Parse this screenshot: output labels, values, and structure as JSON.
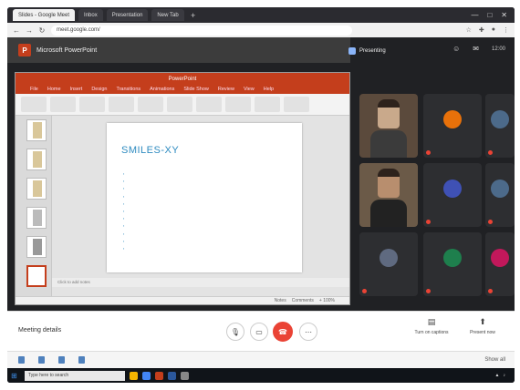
{
  "browser": {
    "tabs": [
      {
        "label": "Slides - Google Meet"
      },
      {
        "label": "Inbox"
      },
      {
        "label": "Presentation"
      },
      {
        "label": "New Tab"
      }
    ],
    "url": "meet.google.com/",
    "window_controls": [
      "—",
      "□",
      "✕"
    ]
  },
  "meet": {
    "share_app": "Microsoft PowerPoint",
    "presenter_label": "Presenting",
    "top_icons": [
      "people-icon",
      "chat-icon",
      "activities-icon"
    ],
    "clock": "12:00"
  },
  "ppt": {
    "window_title": "PowerPoint",
    "account": "",
    "menu": [
      "File",
      "Home",
      "Insert",
      "Design",
      "Transitions",
      "Animations",
      "Slide Show",
      "Review",
      "View",
      "Help"
    ],
    "slide_title": "SMILES-XY",
    "bullets": [
      "",
      "",
      "",
      "",
      "",
      "",
      "",
      "",
      "",
      "",
      ""
    ],
    "notes_placeholder": "Click to add notes",
    "status_items": [
      "Notes",
      "Comments",
      "+ 100%"
    ],
    "thumbnail_count": 6,
    "selected_thumbnail": 1
  },
  "participants": [
    {
      "name": "",
      "initial": "",
      "color": "#e8710a"
    },
    {
      "name": "",
      "initial": "",
      "color": "#4c6a8a"
    },
    {
      "name": "",
      "initial": "",
      "color": "#3f51b5"
    },
    {
      "name": "",
      "initial": "",
      "color": "#4c6a8a"
    },
    {
      "name": "",
      "initial": "",
      "color": "#5f6a80"
    },
    {
      "name": "",
      "initial": "",
      "color": "#1e7f4d"
    },
    {
      "name": "",
      "initial": "",
      "color": "#c2185b"
    }
  ],
  "controls": {
    "meeting_details": "Meeting details",
    "mic_icon": "mic-icon",
    "camera_icon": "camera-icon",
    "end_icon": "phone-end-icon",
    "captions_icon": "captions-icon",
    "present_label": "Present now",
    "captions_label": "Turn on captions"
  },
  "downloads": {
    "items": [
      {
        "name": ""
      },
      {
        "name": ""
      },
      {
        "name": ""
      },
      {
        "name": ""
      }
    ],
    "show_all": "Show all"
  },
  "taskbar": {
    "search_placeholder": "Type here to search",
    "tray_time": ""
  },
  "colors": {
    "ppt_accent": "#c43e1c",
    "end_call": "#ea4335",
    "slide_title": "#2e8bc0",
    "meet_bg": "#202124"
  }
}
